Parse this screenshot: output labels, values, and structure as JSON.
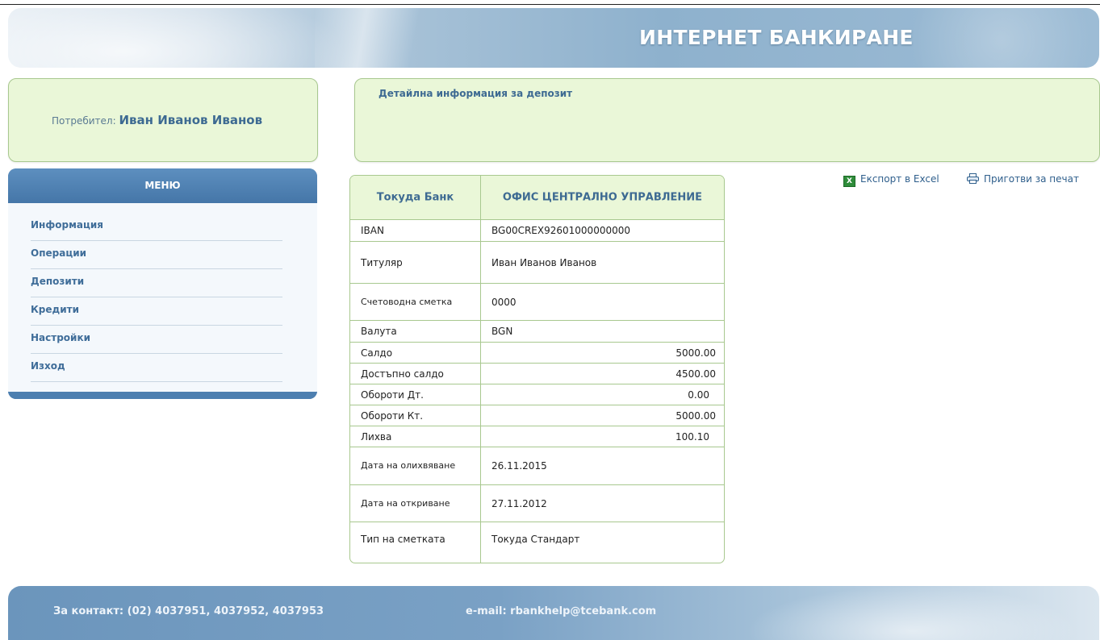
{
  "header": {
    "title": "ИНТЕРНЕТ БАНКИРАНЕ"
  },
  "user": {
    "label": "Потребител:",
    "name": "Иван Иванов Иванов"
  },
  "detail": {
    "title": "Детайлна информация за депозит"
  },
  "menu": {
    "title": "МЕНЮ",
    "items": [
      "Информация",
      "Операции",
      "Депозити",
      "Кредити",
      "Настройки",
      "Изход"
    ]
  },
  "table": {
    "header": [
      "Токуда Банк",
      "ОФИС ЦЕНТРАЛНО УПРАВЛЕНИЕ"
    ],
    "rows": [
      {
        "label": "IBAN",
        "value": "BG00CREX92601000000000"
      },
      {
        "label": "Титуляр",
        "value": "Иван Иванов Иванов"
      },
      {
        "label": "Счетоводна сметка",
        "value": "0000"
      },
      {
        "label": "Валута",
        "value": "BGN"
      },
      {
        "label": "Салдо",
        "value": "5000.00"
      },
      {
        "label": "Достъпно салдо",
        "value": "4500.00"
      },
      {
        "label": "Обороти Дт.",
        "value": "0.00"
      },
      {
        "label": "Обороти Кт.",
        "value": "5000.00"
      },
      {
        "label": "Лихва",
        "value": "100.10"
      },
      {
        "label": "Дата на олихвяване",
        "value": "26.11.2015"
      },
      {
        "label": "Дата на откриване",
        "value": "27.11.2012"
      },
      {
        "label": "Тип на сметката",
        "value": "Токуда Стандарт"
      }
    ]
  },
  "actions": {
    "export_excel": "Експорт в Excel",
    "print": "Приготви за печат"
  },
  "footer": {
    "contact": "За контакт: (02) 4037951, 4037952, 4037953",
    "email": "e-mail: rbankhelp@tcebank.com"
  },
  "colors": {
    "menu_blue": "#4d7fb0",
    "panel_green": "#eaf7d8",
    "border_green": "#a8c88f",
    "link_blue": "#3d6a92"
  }
}
